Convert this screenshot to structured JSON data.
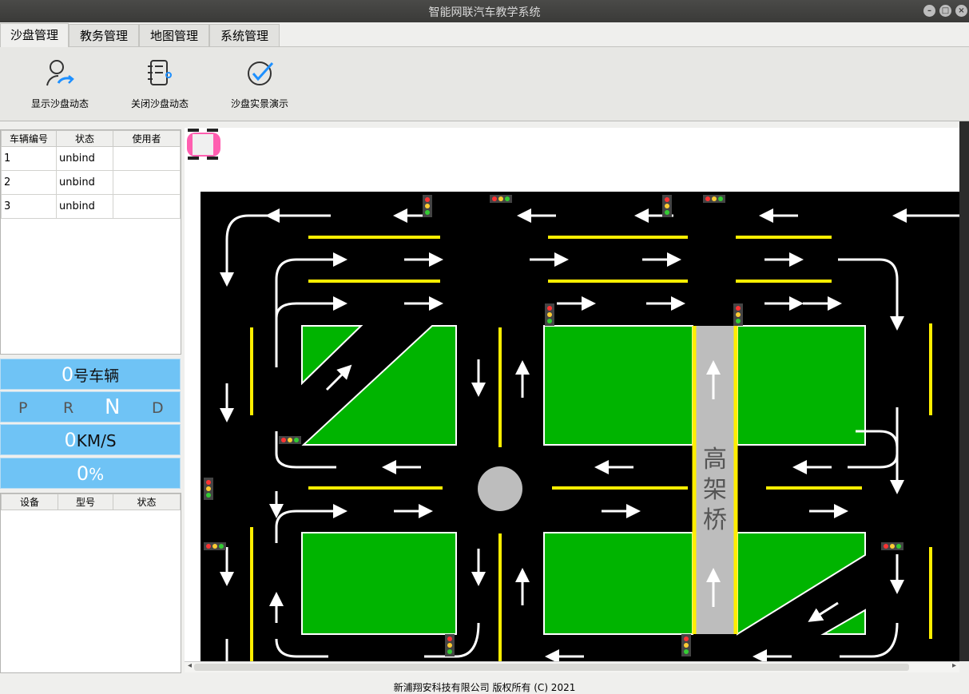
{
  "window": {
    "title": "智能网联汽车教学系统"
  },
  "menu": {
    "tabs": [
      {
        "label": "沙盘管理"
      },
      {
        "label": "教务管理"
      },
      {
        "label": "地图管理"
      },
      {
        "label": "系统管理"
      }
    ]
  },
  "toolbar": {
    "items": [
      {
        "label": "显示沙盘动态",
        "icon": "user-arrow-icon"
      },
      {
        "label": "关闭沙盘动态",
        "icon": "notebook-icon"
      },
      {
        "label": "沙盘实景演示",
        "icon": "check-circle-icon"
      }
    ]
  },
  "vehicles": {
    "headers": [
      "车辆编号",
      "状态",
      "使用者"
    ],
    "rows": [
      {
        "id": "1",
        "status": "unbind",
        "user": ""
      },
      {
        "id": "2",
        "status": "unbind",
        "user": ""
      },
      {
        "id": "3",
        "status": "unbind",
        "user": ""
      }
    ]
  },
  "status": {
    "vehicle_no": "0",
    "vehicle_suffix": "号车辆",
    "gears": [
      "P",
      "R",
      "N",
      "D"
    ],
    "active_gear": "N",
    "speed": "0",
    "speed_unit": "KM/S",
    "percent": "0",
    "percent_unit": "%"
  },
  "devices": {
    "headers": [
      "设备",
      "型号",
      "状态"
    ]
  },
  "map": {
    "bridge_label": "高架桥",
    "colors": {
      "road": "#000000",
      "block": "#00b400",
      "bridge": "#bdbdbd",
      "lane": "#ffee00"
    }
  },
  "footer": {
    "copyright": "新浦翔安科技有限公司 版权所有 (C) 2021"
  }
}
